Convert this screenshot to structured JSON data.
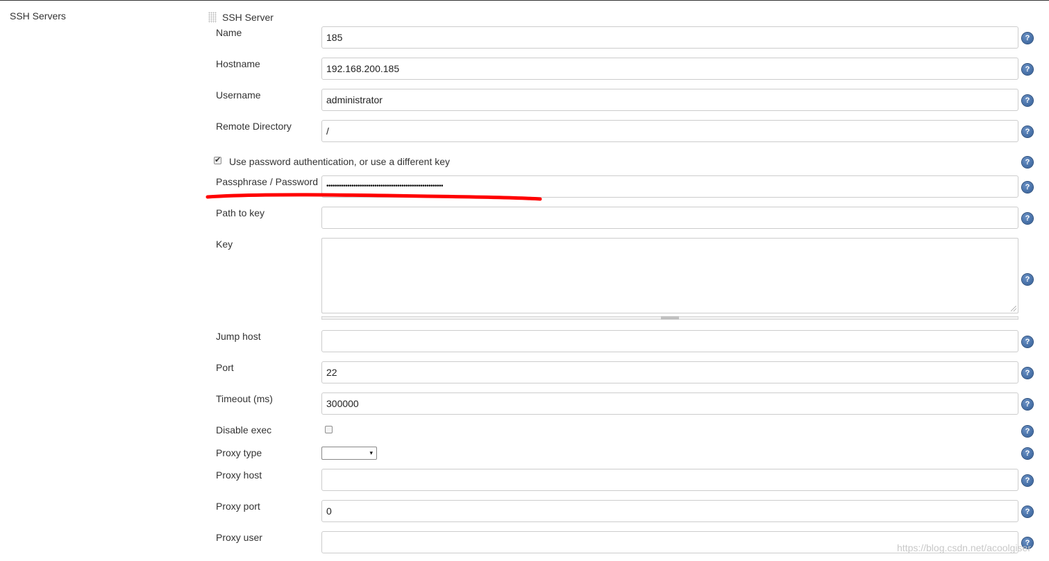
{
  "section": {
    "label": "SSH Servers"
  },
  "server_block": {
    "title": "SSH Server"
  },
  "fields": {
    "name": {
      "label": "Name",
      "value": "185"
    },
    "hostname": {
      "label": "Hostname",
      "value": "192.168.200.185"
    },
    "username": {
      "label": "Username",
      "value": "administrator"
    },
    "remote_directory": {
      "label": "Remote Directory",
      "value": "/"
    },
    "use_password": {
      "label": "Use password authentication, or use a different key",
      "checked": true
    },
    "passphrase": {
      "label": "Passphrase / Password",
      "value": "••••••••••••••••••••••••••••••••••••••••••••••••••••••••"
    },
    "path_to_key": {
      "label": "Path to key",
      "value": ""
    },
    "key": {
      "label": "Key",
      "value": ""
    },
    "jump_host": {
      "label": "Jump host",
      "value": ""
    },
    "port": {
      "label": "Port",
      "value": "22"
    },
    "timeout": {
      "label": "Timeout (ms)",
      "value": "300000"
    },
    "disable_exec": {
      "label": "Disable exec",
      "checked": false
    },
    "proxy_type": {
      "label": "Proxy type",
      "value": ""
    },
    "proxy_host": {
      "label": "Proxy host",
      "value": ""
    },
    "proxy_port": {
      "label": "Proxy port",
      "value": "0"
    },
    "proxy_user": {
      "label": "Proxy user",
      "value": ""
    }
  },
  "icons": {
    "help": "help-icon",
    "drag_handle": "drag-handle-icon",
    "select_arrow": "▾",
    "checkmark": "✔"
  },
  "help_glyph": "?",
  "colors": {
    "help_icon": "#2e5a94",
    "annotation": "#ff0000",
    "field_border": "#cccccc"
  },
  "watermark": "https://blog.csdn.net/acoolgiser"
}
